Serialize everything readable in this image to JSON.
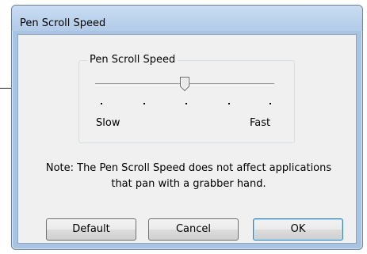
{
  "window": {
    "title": "Pen Scroll Speed"
  },
  "group": {
    "title": "Pen Scroll Speed"
  },
  "slider": {
    "min_label": "Slow",
    "max_label": "Fast",
    "tick_count": 5,
    "selected_index": 2,
    "level": 0.5
  },
  "note": {
    "line1": "Note: The Pen Scroll Speed does not affect applications",
    "line2": "that pan with a grabber hand."
  },
  "buttons": {
    "default_label": "Default",
    "cancel_label": "Cancel",
    "ok_label": "OK"
  }
}
